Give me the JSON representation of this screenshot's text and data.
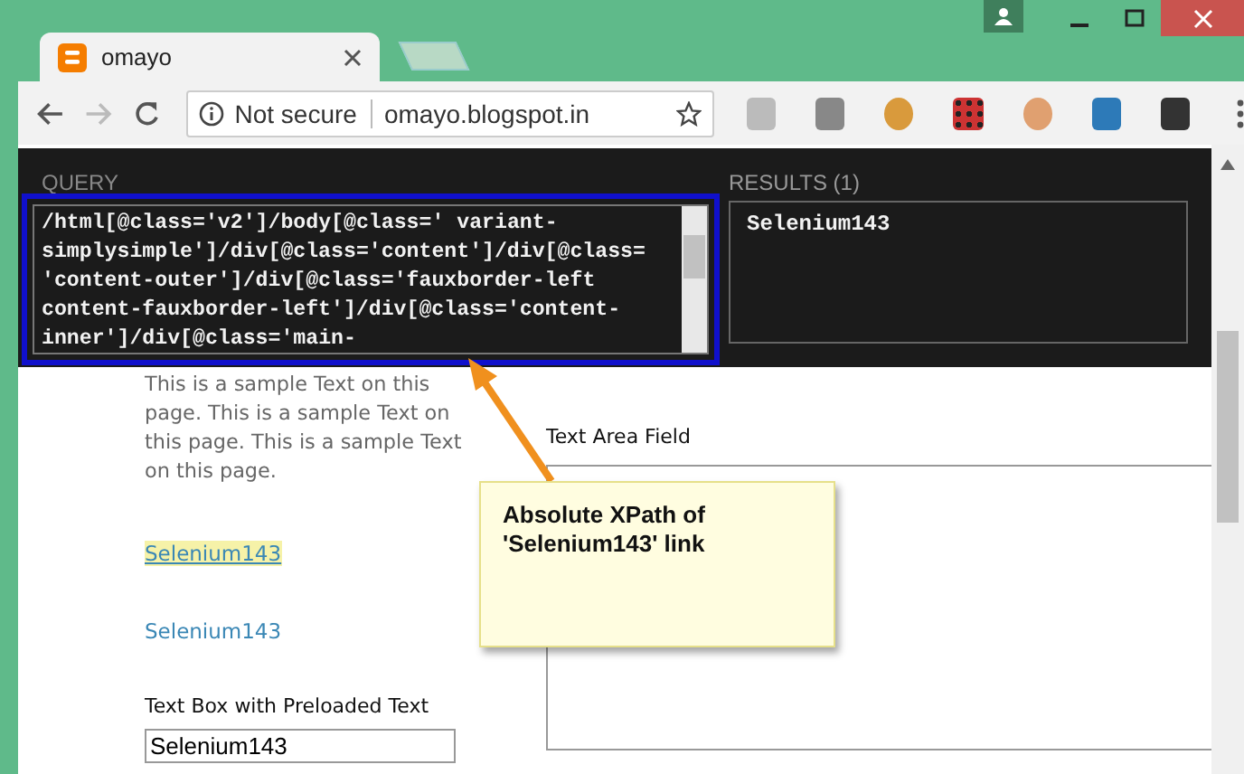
{
  "browser": {
    "tab": {
      "title": "omayo"
    },
    "security": "Not secure",
    "url": "omayo.blogspot.in"
  },
  "page": {
    "paragraph": "This is a sample Text on this page. This is a sample Text on this page. This is a sample Text on this page.",
    "links": [
      {
        "text": "Selenium143",
        "hovered": true
      },
      {
        "text": "Selenium143",
        "hovered": false
      }
    ],
    "textbox_label": "Text Box with Preloaded Text",
    "textbox_value": "Selenium143",
    "textarea_label": "Text Area Field"
  },
  "xpath_panel": {
    "query_label": "QUERY",
    "query": "/html[@class='v2']/body[@class=' variant-simplysimple']/div[@class='content']/div[@class='content-outer']/div[@class='fauxborder-left content-fauxborder-left']/div[@class='content-inner']/div[@class='main-",
    "results_label": "RESULTS (1)",
    "results": [
      "Selenium143"
    ]
  },
  "callout": {
    "text": "Absolute XPath of 'Selenium143' link"
  }
}
